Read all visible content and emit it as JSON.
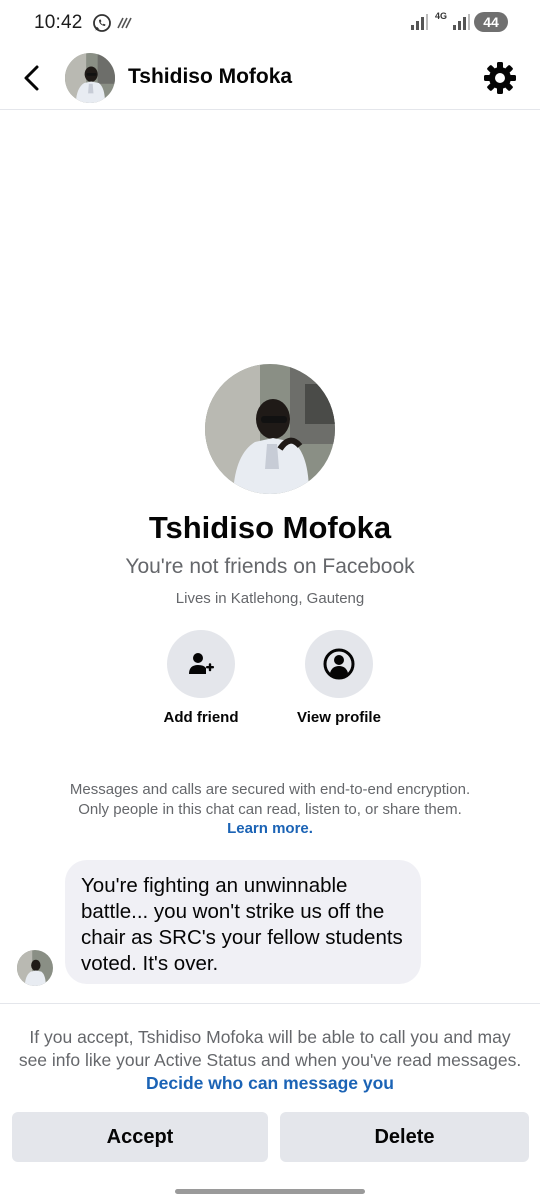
{
  "status_bar": {
    "time": "10:42",
    "network": "4G",
    "battery": "44",
    "icons": [
      "whatsapp-icon",
      "data-saver-icon",
      "signal-icon",
      "signal-icon",
      "battery-icon"
    ]
  },
  "header": {
    "contact_name": "Tshidiso Mofoka",
    "icons": [
      "back-arrow-icon",
      "gear-icon"
    ]
  },
  "profile": {
    "name": "Tshidiso Mofoka",
    "friend_status": "You're not friends on Facebook",
    "location": "Lives in Katlehong, Gauteng",
    "actions": [
      {
        "label": "Add friend",
        "icon": "add-person-icon"
      },
      {
        "label": "View profile",
        "icon": "person-circle-icon"
      }
    ]
  },
  "encryption": {
    "text": "Messages and calls are secured with end-to-end encryption. Only people in this chat can read, listen to, or share them.",
    "link": "Learn more."
  },
  "messages": [
    {
      "text": "You're fighting an unwinnable battle... you won't strike us off the chair as SRC's your fellow students voted. It's over."
    }
  ],
  "request": {
    "text": "If you accept, Tshidiso Mofoka will be able to call you and may see info like your Active Status and when you've read messages.",
    "link": "Decide who can message you",
    "accept_label": "Accept",
    "delete_label": "Delete"
  },
  "colors": {
    "link": "#1b63b5",
    "secondary_text": "#65676b",
    "button_bg": "#e4e6eb",
    "bubble_bg": "#f0f0f5"
  }
}
